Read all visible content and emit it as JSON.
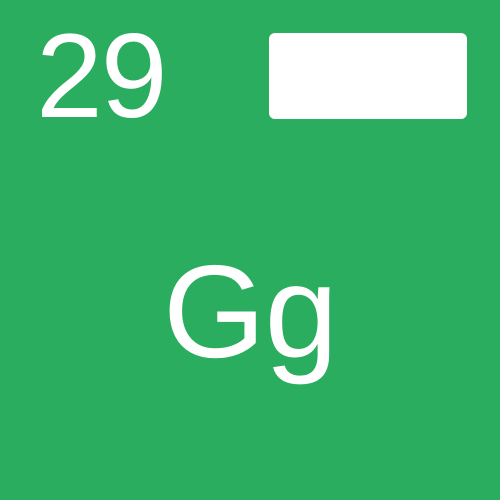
{
  "card": {
    "number": "29",
    "letters": "Gg",
    "background_color": "#2aad5f",
    "text_color": "#ffffff",
    "label_box_color": "#ffffff"
  }
}
